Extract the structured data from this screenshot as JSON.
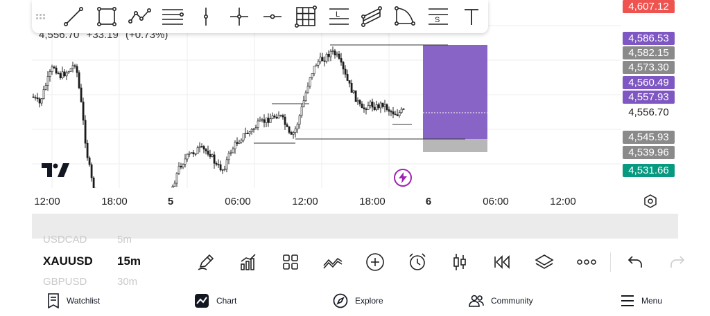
{
  "chart": {
    "ohlc": {
      "close": "4,556.70",
      "change": "+33.19",
      "change_pct": "(+0.73%)"
    },
    "colors": {
      "up": "#ffffff",
      "down": "#1a1a1a",
      "wick": "#222222",
      "accent": "#7e57c2",
      "grid": "#eeeeee"
    },
    "position": {
      "type": "short",
      "profit_color": "#7e57c2",
      "loss_color": "#b7b7b7"
    }
  },
  "drawing_tools": [
    {
      "name": "trend-line-icon"
    },
    {
      "name": "rectangle-icon"
    },
    {
      "name": "path-icon"
    },
    {
      "name": "fib-retracement-icon"
    },
    {
      "name": "vertical-line-icon"
    },
    {
      "name": "cross-line-icon"
    },
    {
      "name": "horizontal-ray-icon"
    },
    {
      "name": "grid-icon"
    },
    {
      "name": "long-position-icon"
    },
    {
      "name": "parallel-channel-icon"
    },
    {
      "name": "arc-icon"
    },
    {
      "name": "short-position-icon"
    },
    {
      "name": "text-icon"
    }
  ],
  "price_scale": {
    "top_label": "4,607.12",
    "top_label_bg": "#ef5350",
    "labels": [
      {
        "value": "4,586.53",
        "bg": "#7e57c2"
      },
      {
        "value": "4,582.15",
        "bg": "#8a8a8a"
      },
      {
        "value": "4,573.30",
        "bg": "#8a8a8a"
      },
      {
        "value": "4,560.49",
        "bg": "#7e57c2"
      },
      {
        "value": "4,557.93",
        "bg": "#7e57c2"
      },
      {
        "value": "4,556.70",
        "bg": ""
      },
      {
        "value": "4,545.93",
        "bg": "#8a8a8a"
      },
      {
        "value": "4,539.96",
        "bg": "#8a8a8a"
      },
      {
        "value": "4,531.66",
        "bg": "#089981"
      }
    ]
  },
  "time_axis": [
    "12:00",
    "18:00",
    "5",
    "06:00",
    "12:00",
    "18:00",
    "6",
    "06:00",
    "12:00"
  ],
  "symbols": {
    "prev": "USDCAD",
    "current": "XAUUSD",
    "next": "GBPUSD"
  },
  "intervals": {
    "prev": "5m",
    "current": "15m",
    "next": "30m"
  },
  "bottom_tools": [
    "pencil-icon",
    "indicators-icon",
    "apps-grid-icon",
    "compare-icon",
    "add-circle-icon",
    "alarm-icon",
    "candles-icon",
    "replay-icon",
    "layers-icon",
    "more-icon"
  ],
  "nav": {
    "watchlist": "Watchlist",
    "chart": "Chart",
    "explore": "Explore",
    "community": "Community",
    "menu": "Menu"
  }
}
